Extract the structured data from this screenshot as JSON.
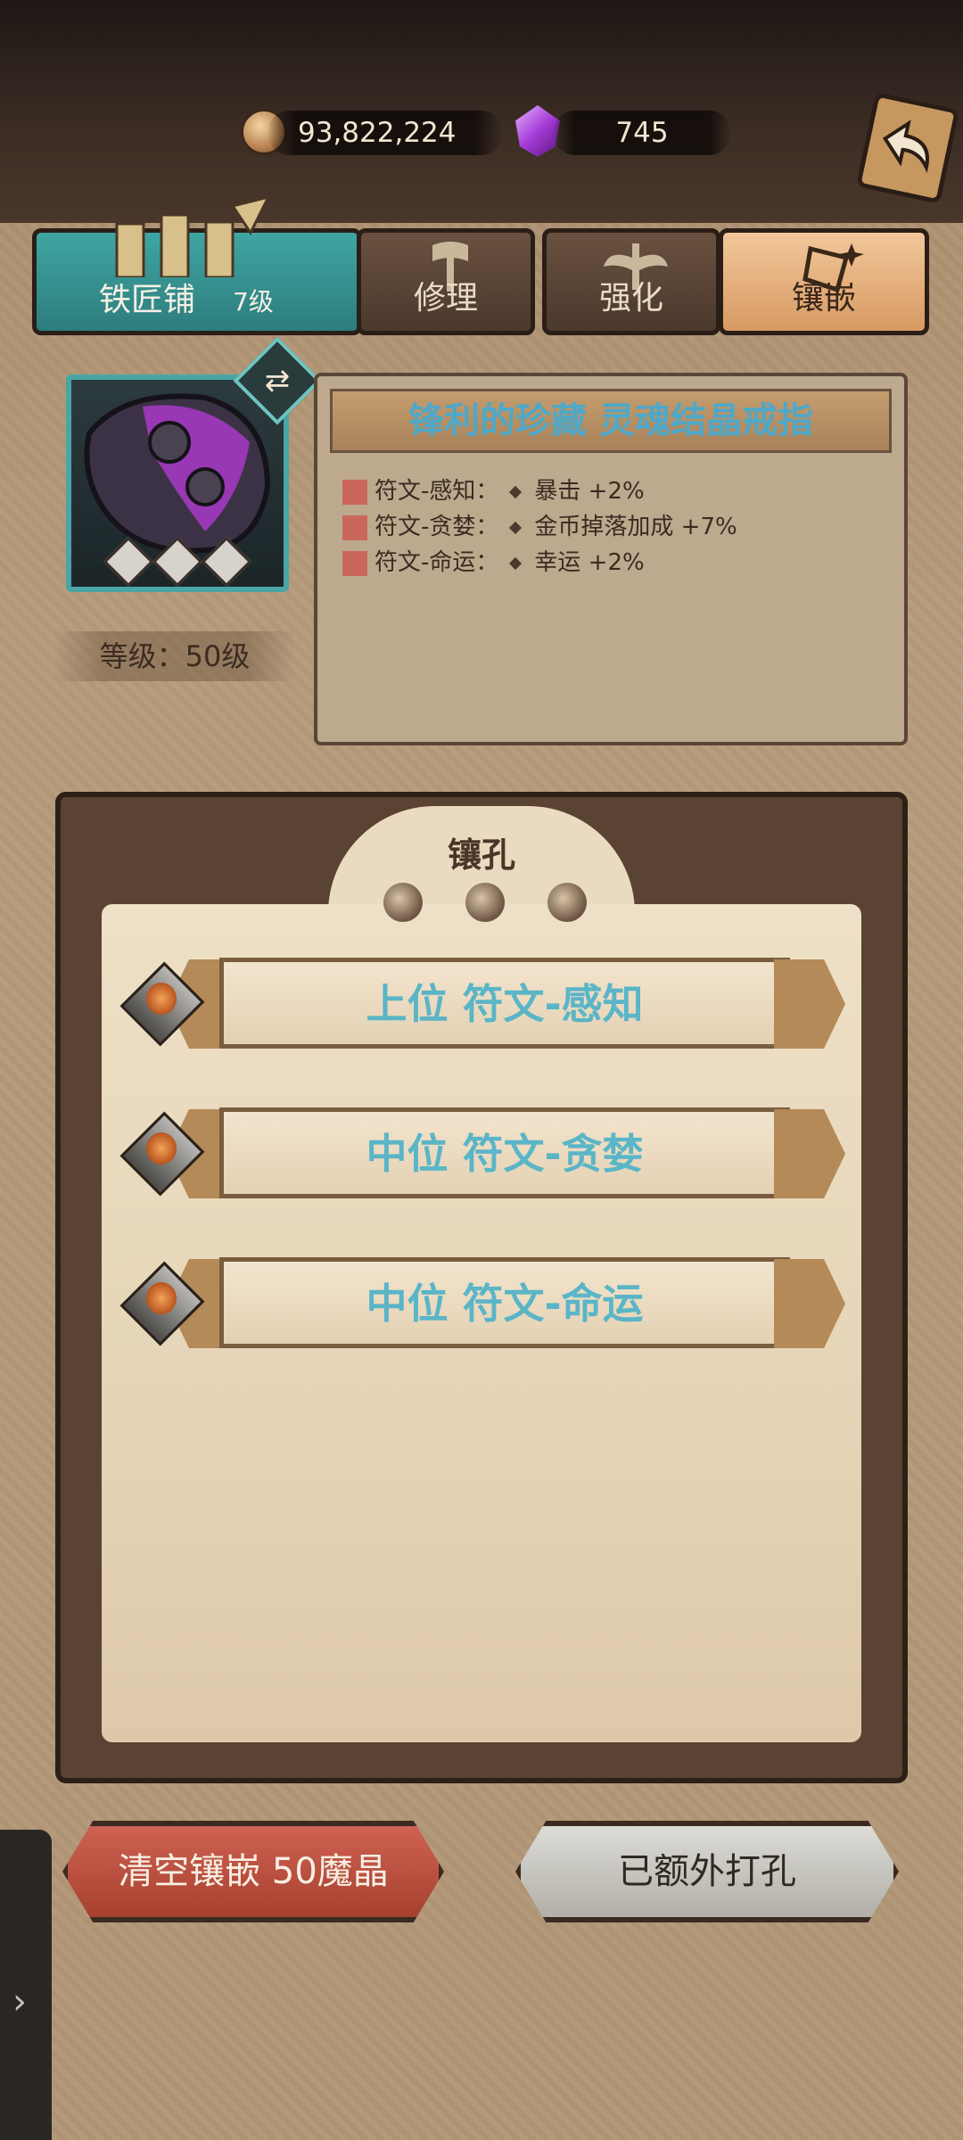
{
  "resources": {
    "gold": "93,822,224",
    "magic_crystal": "745"
  },
  "tabs": {
    "shop": {
      "label": "铁匠铺",
      "level": "7级"
    },
    "repair": "修理",
    "enhance": "强化",
    "inlay": "镶嵌",
    "active": "inlay"
  },
  "item": {
    "name": "锋利的珍藏 灵魂结晶戒指",
    "level": "等级：50级",
    "stars": 3,
    "attributes": [
      {
        "source": "符文-感知：",
        "effect": "暴击 +2%"
      },
      {
        "source": "符文-贪婪：",
        "effect": "金币掉落加成 +7%"
      },
      {
        "source": "符文-命运：",
        "effect": "幸运 +2%"
      }
    ]
  },
  "sockets": {
    "title": "镶孔",
    "runes": [
      {
        "name": "上位 符文-感知"
      },
      {
        "name": "中位 符文-贪婪"
      },
      {
        "name": "中位 符文-命运"
      }
    ]
  },
  "buttons": {
    "clear": "清空镶嵌 50魔晶",
    "extra_hole": "已额外打孔"
  },
  "icons": {
    "coin": "coin-icon",
    "crystal": "crystal-icon",
    "back": "back-arrow-icon",
    "swap": "swap-icon",
    "side": "chevron-right-icon"
  },
  "colors": {
    "rune_text": "#5ab5c7",
    "title_text": "#4fa8c8",
    "clear_button": "#c2513f",
    "active_tab": "#e3ad78"
  }
}
